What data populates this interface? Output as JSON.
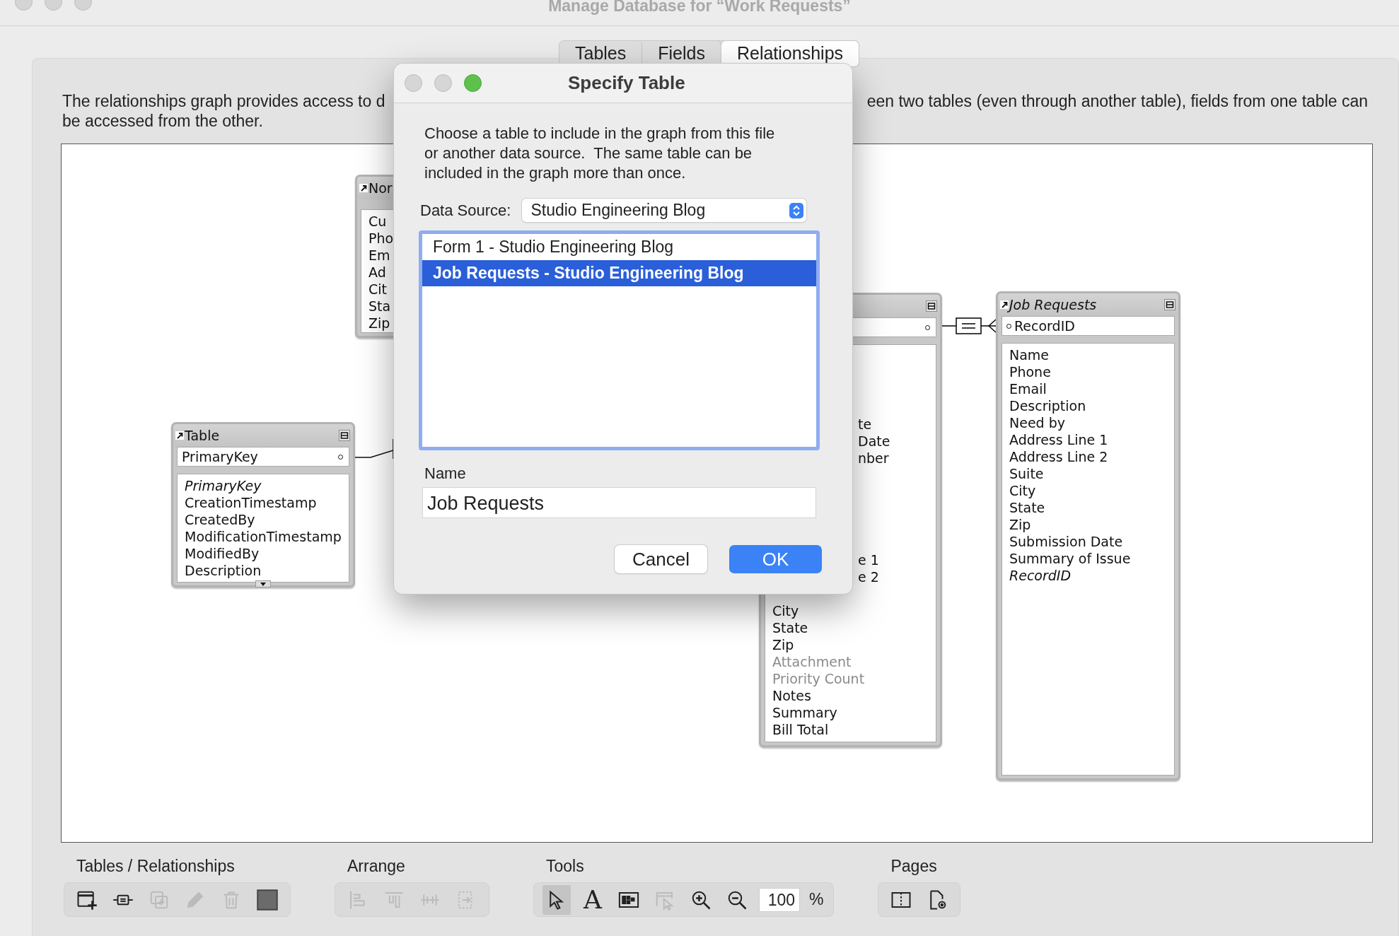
{
  "window": {
    "title": "Manage Database for “Work Requests”"
  },
  "tabs": [
    {
      "label": "Tables",
      "selected": false
    },
    {
      "label": "Fields",
      "selected": false
    },
    {
      "label": "Relationships",
      "selected": true
    }
  ],
  "description": {
    "line_1_start": "The relationships graph provides access to d",
    "line_1_end": "een two tables (even through another table), fields from one table can",
    "line_2": "be accessed from the other."
  },
  "graph": {
    "tables": [
      {
        "title": "Nor",
        "italic_title": false,
        "collapse_button": false,
        "more_below": false,
        "fields": [
          {
            "name": "Cu",
            "kind": "plain"
          },
          {
            "name": "Pho",
            "kind": "plain"
          },
          {
            "name": "Em",
            "kind": "plain"
          },
          {
            "name": "Ad",
            "kind": "plain"
          },
          {
            "name": "Cit",
            "kind": "plain"
          },
          {
            "name": "Sta",
            "kind": "plain"
          },
          {
            "name": "Zip",
            "kind": "plain"
          }
        ]
      },
      {
        "title": "Table",
        "italic_title": false,
        "collapse_button": true,
        "more_below": true,
        "key_field": {
          "name": "PrimaryKey",
          "kind": "dot-after"
        },
        "fields": [
          {
            "name": "PrimaryKey",
            "kind": "italic"
          },
          {
            "name": "CreationTimestamp",
            "kind": "plain"
          },
          {
            "name": "CreatedBy",
            "kind": "plain"
          },
          {
            "name": "ModificationTimestamp",
            "kind": "plain"
          },
          {
            "name": "ModifiedBy",
            "kind": "plain"
          },
          {
            "name": "Description",
            "kind": "plain"
          }
        ]
      },
      {
        "collapse_button": true,
        "more_below": false,
        "key_field": {
          "kind": "dot-after"
        },
        "partial_field_groups": [
          [
            "te",
            "Date",
            "nber"
          ],
          [
            "e 1",
            "e 2"
          ]
        ],
        "fields": [
          {
            "name": "City",
            "kind": "plain"
          },
          {
            "name": "State",
            "kind": "plain"
          },
          {
            "name": "Zip",
            "kind": "plain"
          },
          {
            "name": "Attachment",
            "kind": "dimmed"
          },
          {
            "name": "Priority Count",
            "kind": "dimmed"
          },
          {
            "name": "Notes",
            "kind": "plain"
          },
          {
            "name": "Summary",
            "kind": "plain"
          },
          {
            "name": "Bill Total",
            "kind": "plain"
          }
        ]
      },
      {
        "title": "Job Requests",
        "italic_title": true,
        "collapse_button": true,
        "more_below": false,
        "key_field": {
          "name": "RecordID",
          "kind": "dot-before"
        },
        "fields": [
          {
            "name": "Name",
            "kind": "plain"
          },
          {
            "name": "Phone",
            "kind": "plain"
          },
          {
            "name": "Email",
            "kind": "plain"
          },
          {
            "name": "Description",
            "kind": "plain"
          },
          {
            "name": "Need by",
            "kind": "plain"
          },
          {
            "name": "Address Line 1",
            "kind": "plain"
          },
          {
            "name": "Address Line 2",
            "kind": "plain"
          },
          {
            "name": "Suite",
            "kind": "plain"
          },
          {
            "name": "City",
            "kind": "plain"
          },
          {
            "name": "State",
            "kind": "plain"
          },
          {
            "name": "Zip",
            "kind": "plain"
          },
          {
            "name": "Submission Date",
            "kind": "plain"
          },
          {
            "name": "Summary of Issue",
            "kind": "plain"
          },
          {
            "name": "RecordID",
            "kind": "italic"
          }
        ]
      }
    ]
  },
  "toolbar": [
    {
      "label": "Tables / Relationships",
      "buttons": [
        {
          "kind": "add-table",
          "disabled": false
        },
        {
          "kind": "add-relationship",
          "disabled": false
        },
        {
          "kind": "duplicate",
          "disabled": true
        },
        {
          "kind": "edit",
          "disabled": true
        },
        {
          "kind": "delete",
          "disabled": true
        },
        {
          "kind": "color",
          "disabled": false
        }
      ]
    },
    {
      "label": "Arrange",
      "buttons": [
        {
          "kind": "align-left",
          "disabled": true
        },
        {
          "kind": "align-top",
          "disabled": true
        },
        {
          "kind": "distribute",
          "disabled": true
        },
        {
          "kind": "resize",
          "disabled": true
        }
      ]
    },
    {
      "label": "Tools",
      "buttons": [
        {
          "kind": "pointer",
          "disabled": false,
          "selected": true
        },
        {
          "kind": "text",
          "label": "A",
          "disabled": false,
          "selected": false
        },
        {
          "kind": "field-picker",
          "disabled": false,
          "selected": false
        },
        {
          "kind": "selection-tool",
          "disabled": true,
          "selected": false
        },
        {
          "kind": "zoom-in",
          "disabled": false,
          "selected": false
        },
        {
          "kind": "zoom-out",
          "disabled": false,
          "selected": false
        }
      ],
      "zoom": {
        "value": "100",
        "unit": "%"
      }
    },
    {
      "label": "Pages",
      "buttons": [
        {
          "kind": "page-breaks",
          "disabled": false
        },
        {
          "kind": "page-setup",
          "disabled": false
        }
      ]
    }
  ],
  "dialog": {
    "title": "Specify Table",
    "message": "Choose a table to include in the graph from this file or another data source.  The same table can be included in the graph more than once.",
    "data_source_label": "Data Source:",
    "data_source": "Studio Engineering Blog",
    "tables": [
      {
        "label": "Form 1 - Studio Engineering Blog",
        "selected": false
      },
      {
        "label": "Job Requests - Studio Engineering Blog",
        "selected": true
      }
    ],
    "name_label": "Name",
    "name_value": "Job Requests",
    "buttons": [
      {
        "label": "Cancel",
        "kind": "cancel"
      },
      {
        "label": "OK",
        "kind": "default"
      }
    ]
  }
}
